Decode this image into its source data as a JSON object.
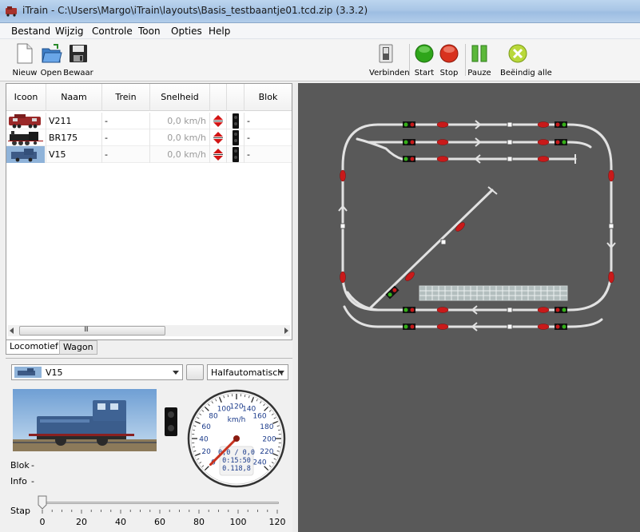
{
  "window": {
    "title": "iTrain - C:\\Users\\Margo\\iTrain\\layouts\\Basis_testbaantje01.tcd.zip (3.3.2)"
  },
  "menu": [
    "Bestand",
    "Wijzig",
    "Controle",
    "Toon",
    "Opties",
    "Help"
  ],
  "toolbar": {
    "new_label": "Nieuw",
    "open_label": "Open",
    "save_label": "Bewaar",
    "connect_label": "Verbinden",
    "start_label": "Start",
    "stop_label": "Stop",
    "pause_label": "Pauze",
    "end_all_label": "Beëindig alle"
  },
  "loco_table": {
    "columns": [
      "Icoon",
      "Naam",
      "Trein",
      "Snelheid",
      "",
      "",
      "Blok"
    ],
    "rows": [
      {
        "name": "V211",
        "train": "-",
        "speed": "0,0 km/h",
        "block": "-",
        "icon": "loco-v211-icon"
      },
      {
        "name": "BR175",
        "train": "-",
        "speed": "0,0 km/h",
        "block": "-",
        "icon": "loco-br175-icon"
      },
      {
        "name": "V15",
        "train": "-",
        "speed": "0,0 km/h",
        "block": "-",
        "icon": "loco-v15-icon"
      }
    ],
    "scroll_thumb_label": "III"
  },
  "tabs": [
    {
      "label": "Locomotief",
      "active": true
    },
    {
      "label": "Wagon",
      "active": false
    }
  ],
  "control": {
    "selected_loco": "V15",
    "mode": "Halfautomatisch",
    "blok_label": "Blok",
    "blok_value": "-",
    "info_label": "Info",
    "info_value": "-",
    "stap_label": "Stap",
    "slider_ticks": [
      "0",
      "20",
      "40",
      "60",
      "80",
      "100",
      "120"
    ],
    "slider_value": 0,
    "speedo": {
      "unit": "km/h",
      "ticks": [
        "0",
        "20",
        "40",
        "60",
        "80",
        "100",
        "120",
        "140",
        "160",
        "180",
        "200",
        "220",
        "240"
      ],
      "readout_line1": "0,0 / 0,0",
      "readout_line2": "0:15:50",
      "readout_line3": "0.118,8",
      "value": 0
    }
  },
  "colors": {
    "layout_bg": "#595959",
    "track": "#e8e8e8",
    "signal_red": "#c81a1a",
    "signal_green": "#34b018",
    "start_green": "#2fa51a",
    "stop_red": "#d8321e"
  }
}
